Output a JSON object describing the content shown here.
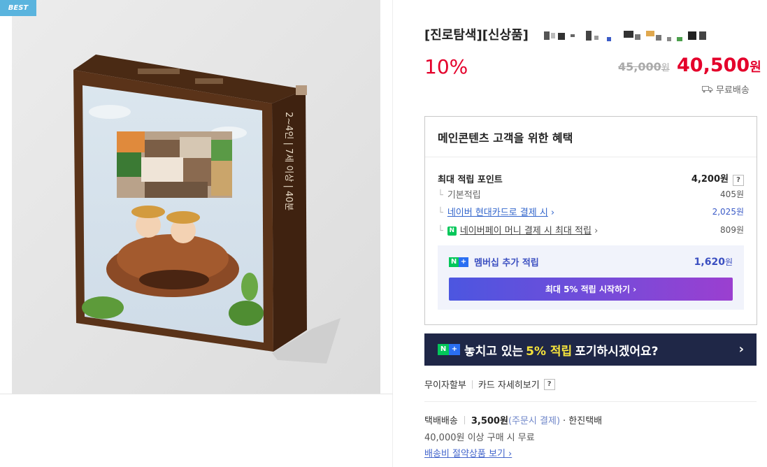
{
  "badge": "BEST",
  "product": {
    "title": "[진로탐색][신상품]",
    "discount": "10%",
    "original_price": "45,000",
    "original_price_unit": "원",
    "sale_price": "40,500",
    "sale_price_unit": "원",
    "shipping_label": "무료배송",
    "box_side_text": "2~4인 | 7세 이상 | 40분"
  },
  "benefit": {
    "heading": "메인콘텐츠 고객을 위한 혜택",
    "max_points_label": "최대 적립 포인트",
    "max_points_value": "4,200원",
    "help": "?",
    "items": [
      {
        "label": "기본적립",
        "value": "405원"
      },
      {
        "label": "네이버 현대카드로 결제 시",
        "value": "2,025원"
      },
      {
        "label": "네이버페이 머니 결제 시 최대 적립",
        "value": "809원"
      }
    ],
    "membership_label": "멤버십 추가 적립",
    "membership_value": "1,620",
    "membership_unit": "원",
    "membership_button": "최대 5% 적립 시작하기 ›"
  },
  "banner": {
    "prefix": "놓치고 있는",
    "highlight": "5% 적립",
    "suffix": "포기하시겠어요?"
  },
  "installment": {
    "label": "무이자할부",
    "card_link": "카드 자세히보기",
    "help": "?"
  },
  "delivery": {
    "type": "택배배송",
    "fee": "3,500원",
    "fee_note": "(주문시 결제)",
    "courier": "· 한진택배",
    "free_condition": "40,000원 이상 구매 시 무료",
    "save_link": "배송비 절약상품 보기 ›"
  },
  "colors": {
    "accent_red": "#e4002b",
    "banner_bg": "#1f2747",
    "highlight_yellow": "#f5e33c",
    "naver_green": "#03c75a"
  }
}
